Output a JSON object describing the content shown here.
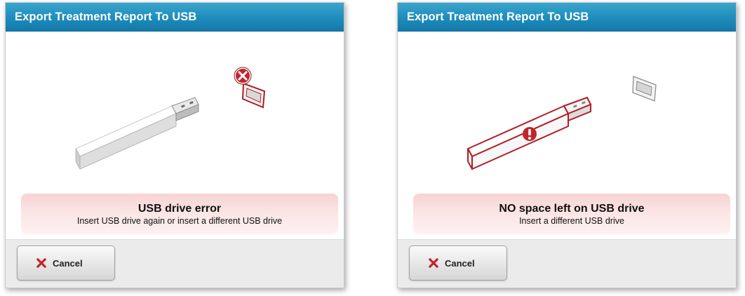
{
  "dialogs": [
    {
      "title": "Export Treatment Report To USB",
      "message_title": "USB drive error",
      "message_detail": "Insert USB drive again or insert a different USB drive",
      "cancel_label": "Cancel",
      "status_icon": "error-x-icon"
    },
    {
      "title": "Export Treatment Report To USB",
      "message_title": "NO space left on USB drive",
      "message_detail": "Insert a different USB drive",
      "cancel_label": "Cancel",
      "status_icon": "warning-exclamation-icon"
    }
  ],
  "colors": {
    "title_bar": "#1e8cbc",
    "error_red": "#c0262c",
    "message_background": "#fbe6e6"
  }
}
